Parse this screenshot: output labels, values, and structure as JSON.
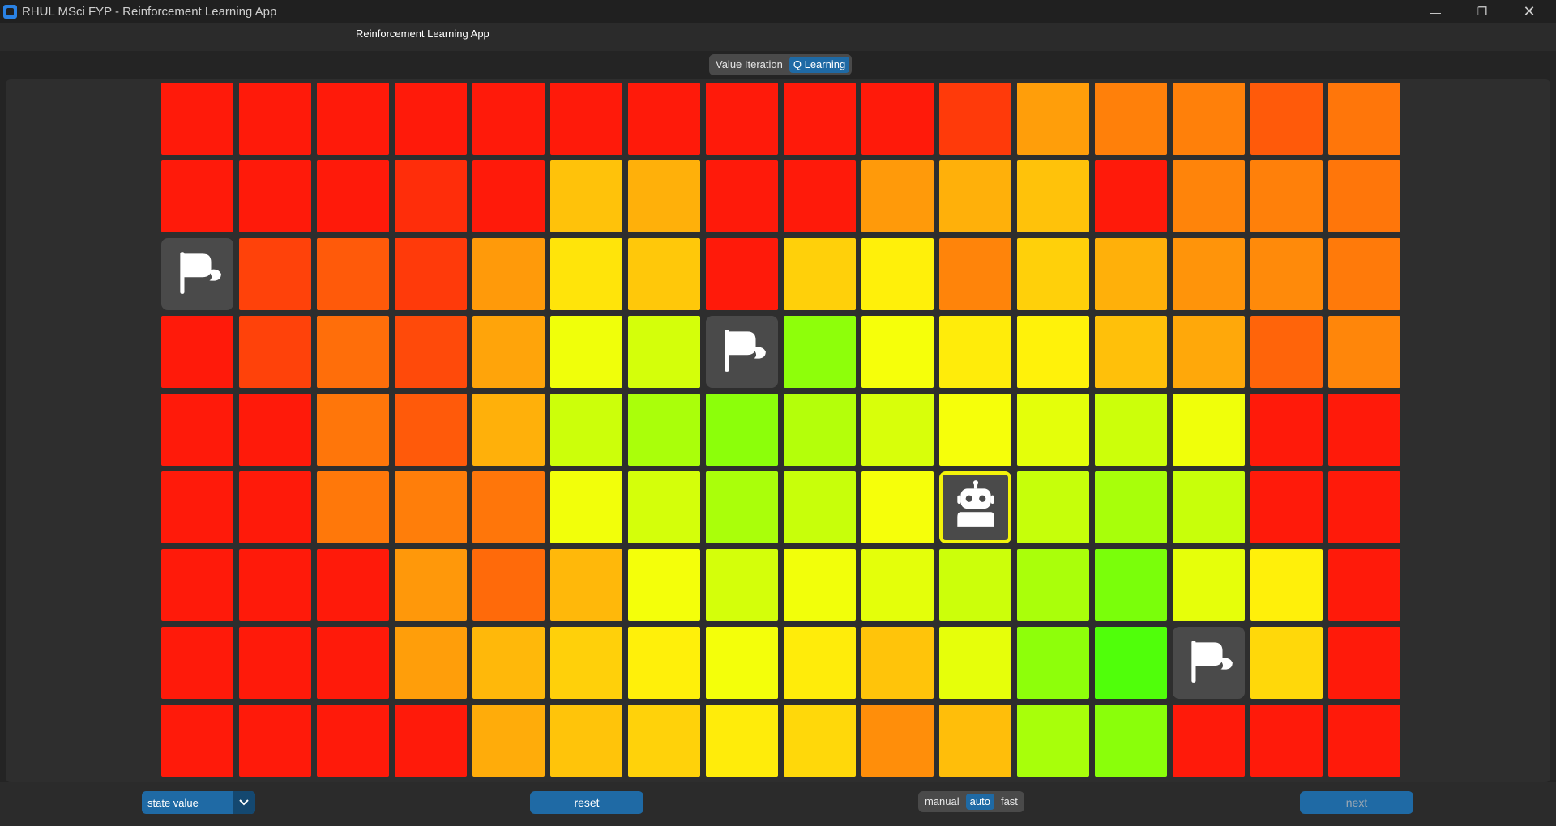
{
  "window": {
    "title": "RHUL MSci FYP - Reinforcement Learning App",
    "min_glyph": "—",
    "max_glyph": "❐",
    "close_glyph": "✕"
  },
  "header": {
    "label": "Reinforcement Learning App"
  },
  "mode": {
    "options": [
      "Value Iteration",
      "Q Learning"
    ],
    "selected": "Q Learning"
  },
  "grid": {
    "rows": 9,
    "cols": 16,
    "agent_cell": [
      5,
      10
    ],
    "goal_cells": [
      [
        2,
        0
      ],
      [
        3,
        7
      ],
      [
        7,
        13
      ]
    ],
    "cell_colors": [
      [
        "#ff1a0a",
        "#ff1a0a",
        "#ff1a0a",
        "#ff1a0a",
        "#ff1a0a",
        "#ff1a0a",
        "#ff1a0a",
        "#ff1a0a",
        "#ff1a0a",
        "#ff1a0a",
        "#ff3a0a",
        "#ff9e0a",
        "#ff800a",
        "#ff800a",
        "#ff5a0a",
        "#ff760a"
      ],
      [
        "#ff1a0a",
        "#ff1a0a",
        "#ff1a0a",
        "#ff2d0a",
        "#ff1a0a",
        "#ffc20a",
        "#ffb00a",
        "#ff1a0a",
        "#ff1a0a",
        "#ff9a0a",
        "#ffb00a",
        "#ffc20a",
        "#ff1a0a",
        "#ff840a",
        "#ff800a",
        "#ff760a"
      ],
      [
        "goal",
        "#ff420a",
        "#ff5a0a",
        "#ff3a0a",
        "#ff9a0a",
        "#ffe40a",
        "#ffc80a",
        "#ff1a0a",
        "#ffd00a",
        "#fff00a",
        "#ff840a",
        "#ffd00a",
        "#ffb00a",
        "#ff940a",
        "#ff8a0a",
        "#ff7a0a"
      ],
      [
        "#ff1a0a",
        "#ff420a",
        "#ff6e0a",
        "#ff4a0a",
        "#ffa40a",
        "#f0ff0a",
        "#d4ff0a",
        "goal",
        "#8eff0a",
        "#f6ff0a",
        "#ffec0a",
        "#fff20a",
        "#ffc00a",
        "#ffa80a",
        "#ff640a",
        "#ff860a"
      ],
      [
        "#ff1a0a",
        "#ff1a0a",
        "#ff760a",
        "#ff5a0a",
        "#ffb00a",
        "#ccff0a",
        "#aaff0a",
        "#8cff0a",
        "#b4ff0a",
        "#d8ff0a",
        "#f6ff0a",
        "#e4ff0a",
        "#ccff0a",
        "#f0ff0a",
        "#ff1a0a",
        "#ff1a0a"
      ],
      [
        "#ff1a0a",
        "#ff1a0a",
        "#ff780a",
        "#ff7e0a",
        "#ff760a",
        "#f2ff0a",
        "#d4ff0a",
        "#aaff0a",
        "#c8ff0a",
        "#f6ff0a",
        "agent",
        "#c6ff0a",
        "#a8ff0a",
        "#c8ff0a",
        "#ff1a0a",
        "#ff1a0a"
      ],
      [
        "#ff1a0a",
        "#ff1a0a",
        "#ff1a0a",
        "#ff980a",
        "#ff6a0a",
        "#ffb80a",
        "#f4ff0a",
        "#d4ff0a",
        "#f2ff0a",
        "#e4ff0a",
        "#ccff0a",
        "#aaff0a",
        "#7aff0a",
        "#e6ff0a",
        "#fff00a",
        "#ff1a0a"
      ],
      [
        "#ff1a0a",
        "#ff1a0a",
        "#ff1a0a",
        "#ff9e0a",
        "#ffb80a",
        "#ffd00a",
        "#fff00a",
        "#f4ff0a",
        "#ffec0a",
        "#ffc40a",
        "#e6ff0a",
        "#8eff0a",
        "#50ff0a",
        "goal",
        "#ffd80a",
        "#ff1a0a"
      ],
      [
        "#ff1a0a",
        "#ff1a0a",
        "#ff1a0a",
        "#ff1a0a",
        "#ffac0a",
        "#ffc40a",
        "#ffd20a",
        "#ffec0a",
        "#ffd80a",
        "#ff8e0a",
        "#ffbe0a",
        "#a8ff0a",
        "#8aff0a",
        "#ff1a0a",
        "#ff1a0a",
        "#ff1a0a"
      ]
    ]
  },
  "bottom": {
    "view_select": {
      "value": "state value"
    },
    "reset_label": "reset",
    "speed": {
      "options": [
        "manual",
        "auto",
        "fast"
      ],
      "selected": "auto"
    },
    "next_label": "next"
  }
}
